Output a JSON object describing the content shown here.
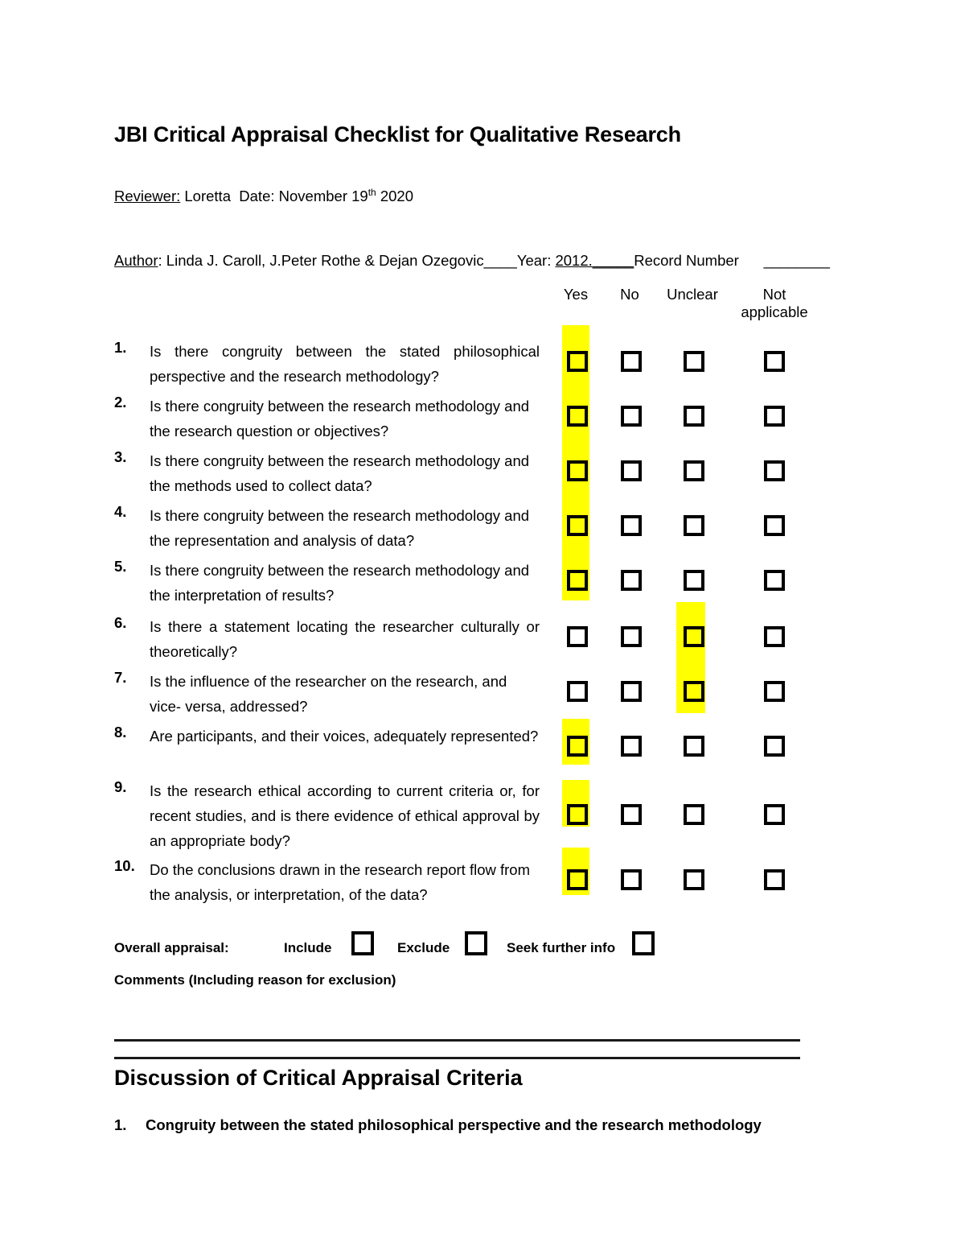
{
  "document": {
    "title": "JBI Critical Appraisal Checklist for Qualitative Research",
    "reviewer_label": "Reviewer:",
    "reviewer_value": "Loretta",
    "date_label": "Date:",
    "date_value_month": "November 19",
    "date_value_sup": "th",
    "date_value_year": "2020",
    "author_label": "Author",
    "author_colon": ":",
    "author_value": "Linda J. Caroll, J.Peter Rothe & Dejan Ozegovic____",
    "year_label": "Year:",
    "year_value": "2012.",
    "year_blank": "_____",
    "record_number_label": "Record Number",
    "record_number_blank": "________"
  },
  "columns": [
    {
      "key": "yes",
      "label": "Yes",
      "label_line2": ""
    },
    {
      "key": "no",
      "label": "No",
      "label_line2": ""
    },
    {
      "key": "unclear",
      "label": "Unclear",
      "label_line2": ""
    },
    {
      "key": "not_applicable",
      "label": "Not",
      "label_line2": "applicable"
    }
  ],
  "questions": [
    {
      "num": "1.",
      "text": "Is there congruity between the stated philosophical perspective and the research methodology?",
      "selected": "yes"
    },
    {
      "num": "2.",
      "text": "Is there congruity between the research methodology and the research question or objectives?",
      "selected": "yes"
    },
    {
      "num": "3.",
      "text": "Is there congruity between the research methodology and the methods used to collect data?",
      "selected": "yes"
    },
    {
      "num": "4.",
      "text": "Is there congruity between the research methodology and the representation and analysis of data?",
      "selected": "yes"
    },
    {
      "num": "5.",
      "text": "Is there congruity between the research methodology and the interpretation of results?",
      "selected": "yes"
    },
    {
      "num": "6.",
      "text": "Is there a statement locating the researcher culturally or theoretically?",
      "selected": "unclear"
    },
    {
      "num": "7.",
      "text": "Is the influence of the researcher on the research, and vice- versa, addressed?",
      "selected": "unclear"
    },
    {
      "num": "8.",
      "text": "Are participants, and their voices, adequately represented?",
      "selected": "yes"
    },
    {
      "num": "9.",
      "text": "Is the research ethical according to current criteria or, for recent studies, and is there evidence of ethical approval by an appropriate body?",
      "selected": "yes"
    },
    {
      "num": "10.",
      "text": "Do the conclusions drawn in the research report flow from the analysis, or interpretation, of the data?",
      "selected": "yes"
    }
  ],
  "overall": {
    "label": "Overall appraisal:",
    "options": [
      {
        "label": "Include",
        "checked": false
      },
      {
        "label": "Exclude",
        "checked": false
      },
      {
        "label": "Seek further info",
        "checked": false
      }
    ],
    "comments_label": "Comments (Including reason for exclusion)"
  },
  "discussion": {
    "section_title": "Discussion of Critical Appraisal Criteria",
    "items": [
      {
        "num": "1.",
        "text": "Congruity between the stated philosophical perspective and the research methodology"
      }
    ]
  },
  "colors": {
    "highlight": "#FFFF00",
    "text": "#000000",
    "rule": "#1a1a1a",
    "page_background": "#FFFFFF"
  }
}
